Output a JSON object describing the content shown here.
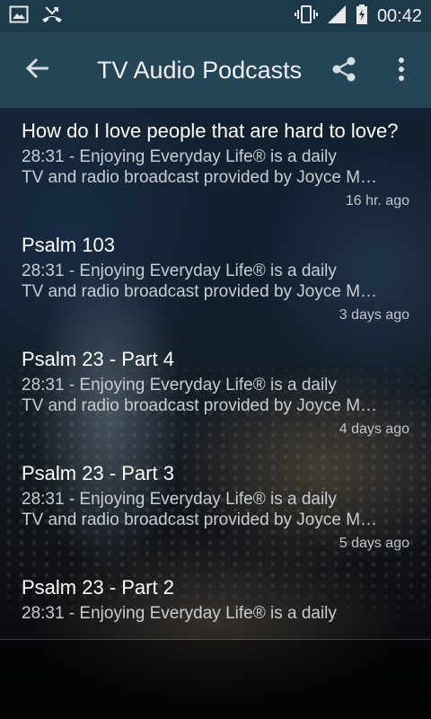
{
  "status_bar": {
    "time": "00:42",
    "icons": [
      "image-icon",
      "missed-call-icon",
      "vibrate-icon",
      "signal-icon",
      "battery-charging-icon"
    ]
  },
  "app_bar": {
    "title": "TV Audio Podcasts",
    "icons": [
      "back-arrow-icon",
      "share-icon",
      "overflow-menu-icon"
    ]
  },
  "episodes": [
    {
      "title": "How do I love people that are hard to love?",
      "desc_line1": "28:31 - Enjoying Everyday Life® is a daily",
      "desc_line2": "TV and radio broadcast provided by Joyce Meyer",
      "age": "16 hr. ago"
    },
    {
      "title": "Psalm 103",
      "desc_line1": "28:31 - Enjoying Everyday Life® is a daily",
      "desc_line2": "TV and radio broadcast provided by Joyce Meyer",
      "age": "3 days ago"
    },
    {
      "title": "Psalm 23 - Part 4",
      "desc_line1": "28:31 - Enjoying Everyday Life® is a daily",
      "desc_line2": "TV and radio broadcast provided by Joyce Meyer",
      "age": "4 days ago"
    },
    {
      "title": "Psalm 23 - Part 3",
      "desc_line1": "28:31 - Enjoying Everyday Life® is a daily",
      "desc_line2": "TV and radio broadcast provided by Joyce Meyer",
      "age": "5 days ago"
    },
    {
      "title": "Psalm 23 - Part 2",
      "desc_line1": "28:31 - Enjoying Everyday Life® is a daily",
      "desc_line2": "",
      "age": ""
    }
  ],
  "colors": {
    "status_bar": "#1d3a4a",
    "app_bar": "#244556",
    "title_text": "#ffffff",
    "secondary_text": "#c8cdd1"
  }
}
